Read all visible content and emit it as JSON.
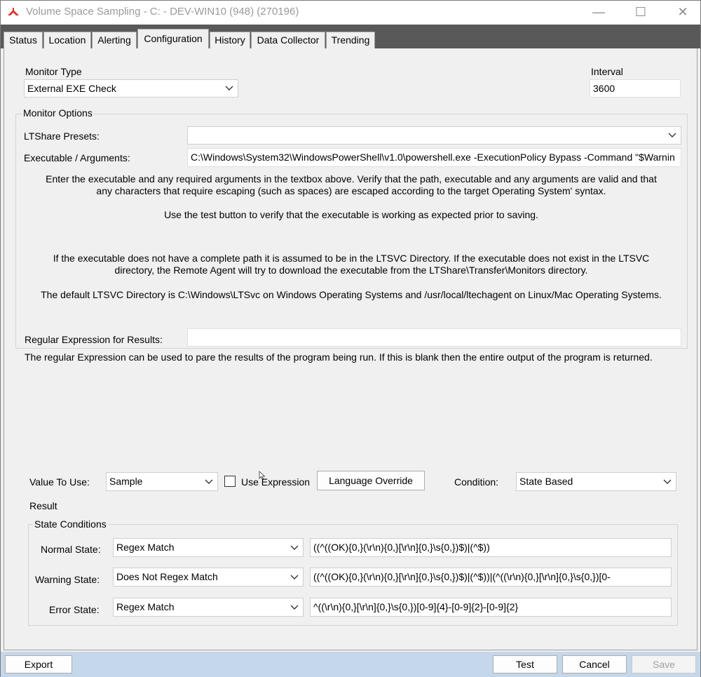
{
  "window": {
    "title": "Volume Space Sampling - C: - DEV-WIN10 (948) (270196)",
    "minimize": "—",
    "maximize": "☐",
    "close": "✕"
  },
  "tabs": [
    "Status",
    "Location",
    "Alerting",
    "Configuration",
    "History",
    "Data Collector",
    "Trending"
  ],
  "active_tab": "Configuration",
  "monitor_type": {
    "label": "Monitor Type",
    "value": "External EXE Check"
  },
  "interval": {
    "label": "Interval",
    "value": "3600"
  },
  "monitor_options": {
    "title": "Monitor Options",
    "presets_label": "LTShare Presets:",
    "presets_value": "",
    "exe_label": "Executable / Arguments:",
    "exe_value": "C:\\Windows\\System32\\WindowsPowerShell\\v1.0\\powershell.exe -ExecutionPolicy Bypass -Command \"$Warnin",
    "help1_line1": "Enter the executable and any required arguments in the textbox above. Verify that the path, executable and any arguments are valid and that",
    "help1_line2": "any characters that require escaping (such as spaces) are escaped according to the target Operating System' syntax.",
    "help2": "Use the test button to verify that the executable is working as expected prior to saving.",
    "help3_line1": "If the executable does not have a complete path it is assumed to be in the LTSVC Directory. If the executable does not exist in the LTSVC",
    "help3_line2": "directory, the Remote Agent will try to download the executable from the LTShare\\Transfer\\Monitors directory.",
    "help4": "The default LTSVC Directory is C:\\Windows\\LTSvc on Windows Operating Systems and /usr/local/ltechagent on Linux/Mac Operating Systems.",
    "regex_label": "Regular Expression for Results:",
    "regex_value": "",
    "regex_help": "The regular Expression can be used to pare the results of the program being run. If this is blank then the entire output of the program is returned."
  },
  "result": {
    "value_to_use_label": "Value To Use:",
    "value_to_use": "Sample",
    "use_expression_label": "Use Expression",
    "use_expression_checked": false,
    "language_override": "Language Override",
    "condition_label": "Condition:",
    "condition_value": "State Based",
    "result_label": "Result",
    "state_conditions_title": "State Conditions",
    "states": [
      {
        "label": "Normal State:",
        "mode": "Regex Match",
        "expr": "((^((OK){0,}(\\r\\n){0,}[\\r\\n]{0,}\\s{0,})$)|(^$))"
      },
      {
        "label": "Warning State:",
        "mode": "Does Not Regex Match",
        "expr": "((^((OK){0,}(\\r\\n){0,}[\\r\\n]{0,}\\s{0,})$)|(^$))|(^((\\r\\n){0,}[\\r\\n]{0,}\\s{0,})[0-"
      },
      {
        "label": "Error State:",
        "mode": "Regex Match",
        "expr": "^((\\r\\n){0,}[\\r\\n]{0,}\\s{0,})[0-9]{4}-[0-9]{2}-[0-9]{2}"
      }
    ]
  },
  "buttons": {
    "export": "Export",
    "test": "Test",
    "cancel": "Cancel",
    "save": "Save"
  },
  "colors": {
    "tabstrip": "#595959",
    "bottombar": "#c5d7ea",
    "title_text": "#9a9a9a",
    "app_icon": "#d9342b"
  }
}
